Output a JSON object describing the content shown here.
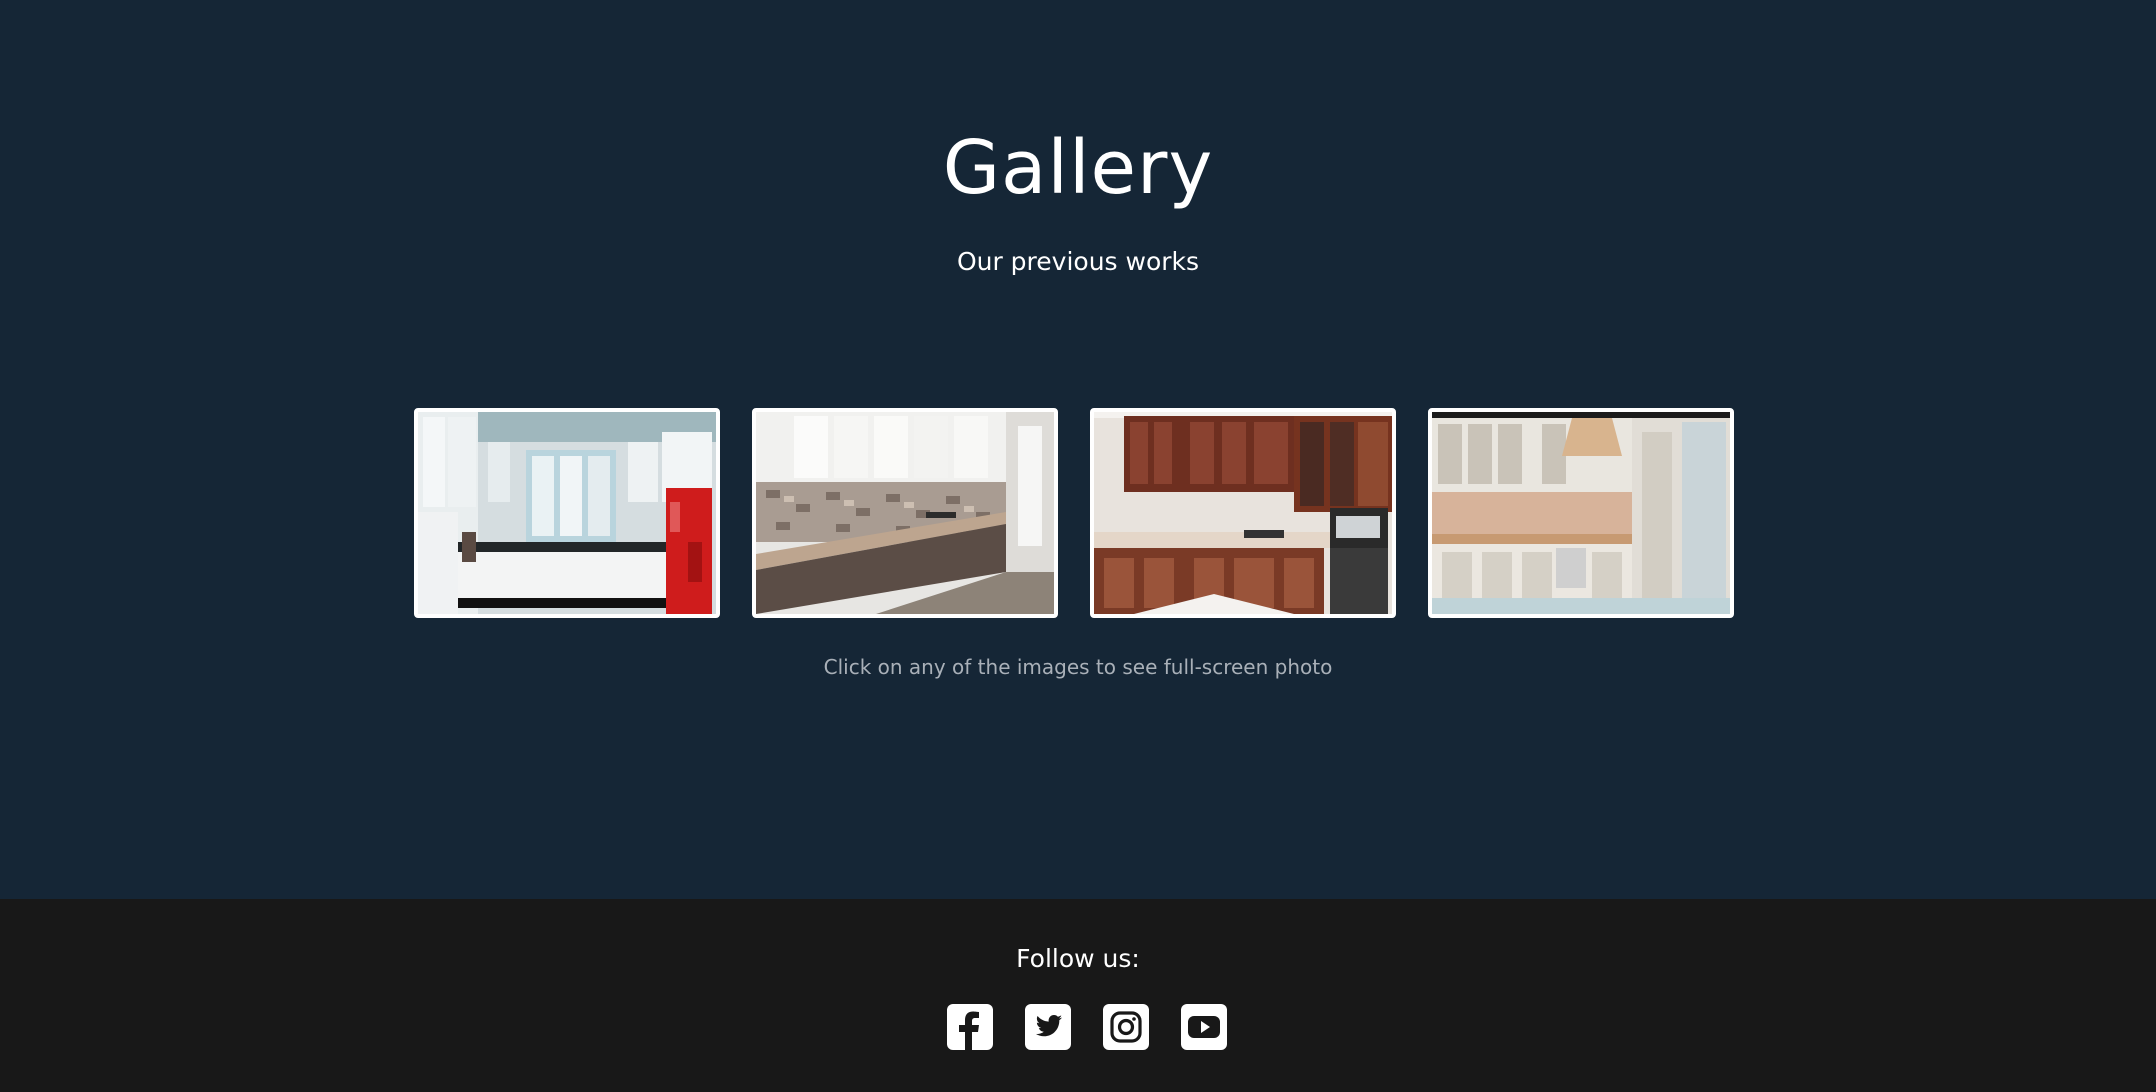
{
  "gallery": {
    "title": "Gallery",
    "subtitle": "Our previous works",
    "hint": "Click on any of the images to see full-screen photo",
    "images": [
      {
        "name": "white-u-shaped-kitchen"
      },
      {
        "name": "grey-linear-kitchen"
      },
      {
        "name": "wooden-corner-kitchen"
      },
      {
        "name": "classic-white-kitchen"
      }
    ]
  },
  "footer": {
    "follow_label": "Follow us:",
    "social": [
      {
        "icon": "facebook-icon"
      },
      {
        "icon": "twitter-icon"
      },
      {
        "icon": "instagram-icon"
      },
      {
        "icon": "youtube-icon"
      }
    ]
  },
  "colors": {
    "gallery_bg": "#152636",
    "footer_bg": "#181818",
    "text": "#ffffff",
    "hint_text": "#a9b0b8"
  }
}
